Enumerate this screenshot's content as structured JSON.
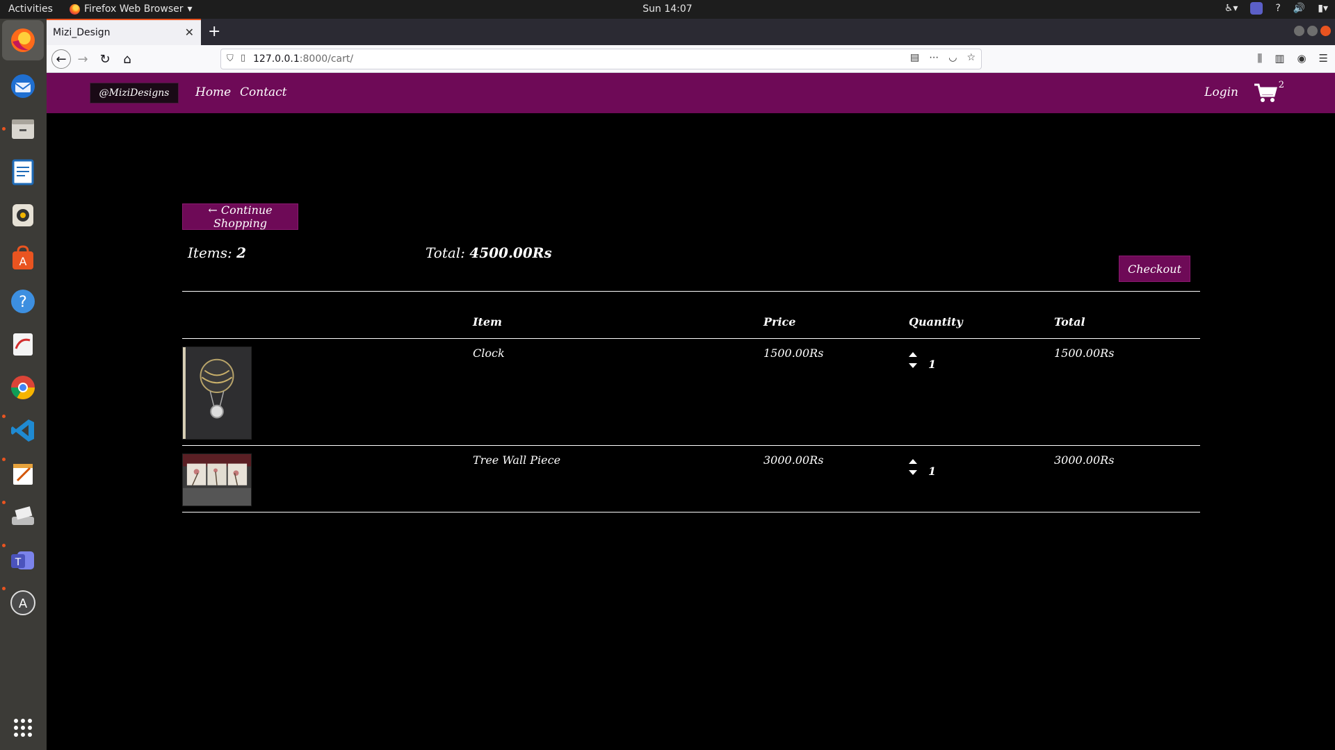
{
  "system": {
    "activities": "Activities",
    "app_name": "Firefox Web Browser",
    "clock": "Sun 14:07",
    "tray_help": "?"
  },
  "dock": {
    "items": [
      "firefox-icon",
      "thunderbird-icon",
      "files-icon",
      "writer-icon",
      "rhythmbox-icon",
      "software-center-icon",
      "help-icon",
      "document-viewer-icon",
      "chrome-icon",
      "vscode-icon",
      "text-editor-icon",
      "scanner-icon",
      "teams-icon",
      "software-updater-icon",
      "show-apps-icon"
    ]
  },
  "browser": {
    "tab_title": "Mizi_Design",
    "url_host": "127.0.0.1",
    "url_path": ":8000/cart/"
  },
  "site": {
    "brand": "@MiziDesigns",
    "nav": {
      "home": "Home",
      "contact": "Contact",
      "login": "Login"
    },
    "cart_count": "2",
    "accent_color": "#6e0a57"
  },
  "cart": {
    "continue_label": "← Continue Shopping",
    "items_label": "Items:",
    "items_count": "2",
    "total_label": "Total:",
    "total_value": "4500.00Rs",
    "checkout_label": "Checkout",
    "headers": {
      "item": "Item",
      "price": "Price",
      "quantity": "Quantity",
      "total": "Total"
    },
    "rows": [
      {
        "name": "Clock",
        "price": "1500.00Rs",
        "qty": "1",
        "total": "1500.00Rs",
        "image": "hot-air-balloon-clock"
      },
      {
        "name": "Tree Wall Piece",
        "price": "3000.00Rs",
        "qty": "1",
        "total": "3000.00Rs",
        "image": "tree-wall-art"
      }
    ]
  }
}
